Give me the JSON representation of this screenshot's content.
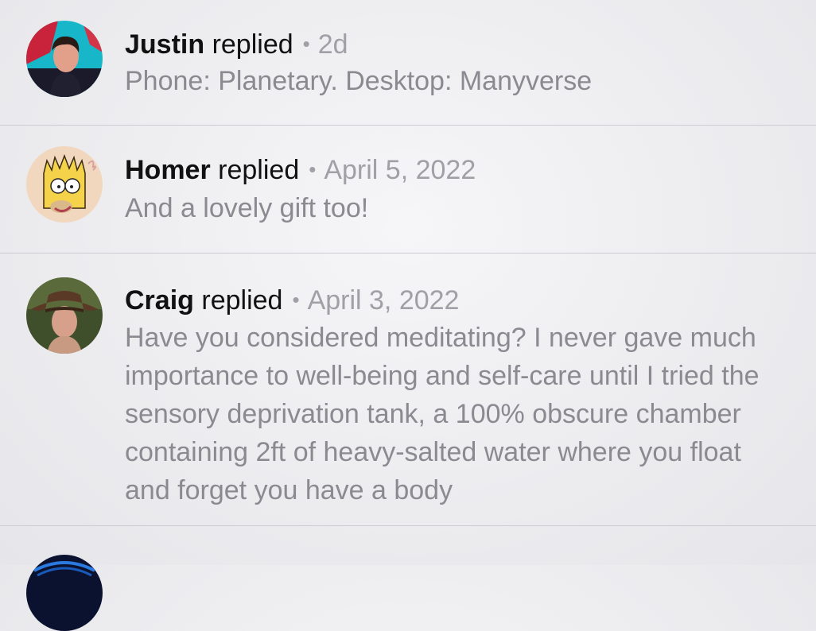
{
  "replies": [
    {
      "name": "Justin",
      "verb": "replied",
      "separator": "•",
      "time": "2d",
      "text": "Phone: Planetary. Desktop: Manyverse"
    },
    {
      "name": "Homer",
      "verb": "replied",
      "separator": "•",
      "time": "April 5, 2022",
      "text": "And a lovely gift too!"
    },
    {
      "name": "Craig",
      "verb": "replied",
      "separator": "•",
      "time": "April 3, 2022",
      "text": "Have you considered meditating? I never gave much importance to well-being and self-care until I tried the sensory deprivation tank, a 100% obscure chamber containing 2ft of heavy-salted water where you float and forget you have a body"
    }
  ]
}
